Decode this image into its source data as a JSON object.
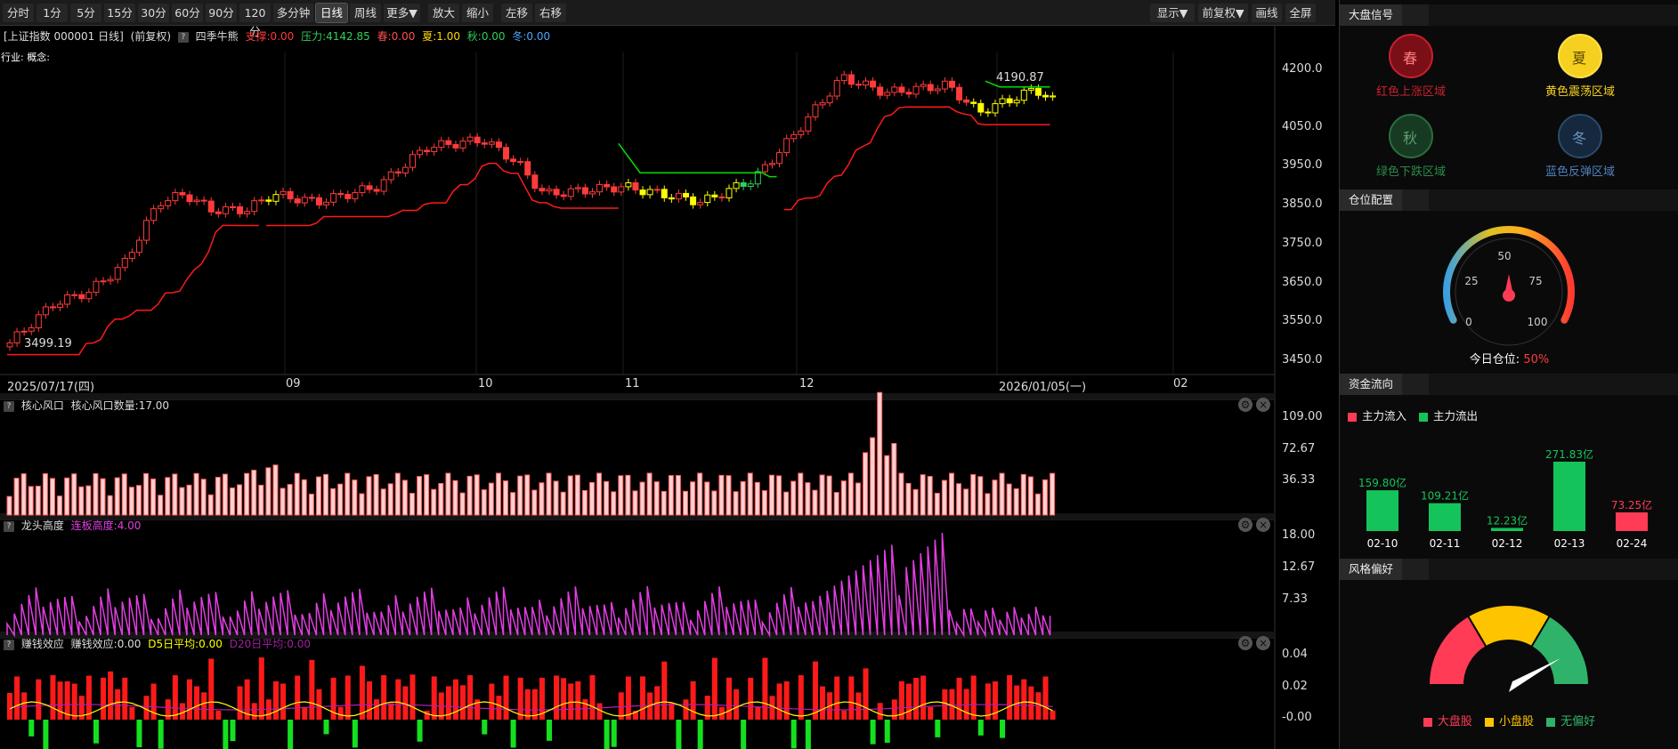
{
  "toolbar": {
    "periods": [
      "分时",
      "1分",
      "5分",
      "15分",
      "30分",
      "60分",
      "90分",
      "120分",
      "多分钟",
      "日线",
      "周线",
      "更多▼",
      "放大",
      "缩小",
      "左移",
      "右移"
    ],
    "active": "日线",
    "right": [
      "显示▼",
      "前复权▼",
      "画线",
      "全屏"
    ]
  },
  "main_header": {
    "title": "[上证指数 000001 日线]",
    "adj": "(前复权)",
    "indicator": "四季牛熊",
    "support": "支撑:0.00",
    "pressure": "压力:4142.85",
    "spring": "春:0.00",
    "summer": "夏:1.00",
    "autumn": "秋:0.00",
    "winter": "冬:0.00",
    "industry": "行业: 概念:"
  },
  "main_axis": {
    "ticks": [
      "4200.0",
      "4050.0",
      "3950.0",
      "3850.0",
      "3750.0",
      "3650.0",
      "3550.0",
      "3450.0"
    ],
    "dates": [
      "2025/07/17(四)",
      "09",
      "10",
      "11",
      "12",
      "2026/01/05(一)",
      "02"
    ],
    "high_label": "4190.87",
    "low_label": "3499.19"
  },
  "panel1": {
    "name": "核心风口",
    "value": "核心风口数量:17.00",
    "ticks": [
      "109.00",
      "72.67",
      "36.33"
    ]
  },
  "panel2": {
    "name": "龙头高度",
    "value": "连板高度:4.00",
    "ticks": [
      "18.00",
      "12.67",
      "7.33"
    ]
  },
  "panel3": {
    "name": "赚钱效应",
    "value": "赚钱效应:0.00",
    "d5": "D5日平均:0.00",
    "d20": "D20日平均:0.00",
    "ticks": [
      "0.04",
      "0.02",
      "-0.00"
    ]
  },
  "colors": {
    "up": "#ff3b3b",
    "down_green": "#2fd05a",
    "yellow": "#ffff00",
    "support_red": "#ff1a1a",
    "pressure_green": "#00e000",
    "magenta": "#e23ee2",
    "bar_pink": "#ff9a9a"
  },
  "side": {
    "signal": {
      "title": "大盘信号",
      "items": [
        {
          "glyph": "春",
          "label": "红色上涨区域",
          "color": "#c8202c"
        },
        {
          "glyph": "夏",
          "label": "黄色震荡区域",
          "color": "#f5d020"
        },
        {
          "glyph": "秋",
          "label": "绿色下跌区域",
          "color": "#2a6e3c"
        },
        {
          "glyph": "冬",
          "label": "蓝色反弹区域",
          "color": "#2b4a6e"
        }
      ]
    },
    "position": {
      "title": "仓位配置",
      "ticks": [
        "0",
        "25",
        "50",
        "75",
        "100"
      ],
      "today_label": "今日仓位:",
      "today_value": "50%",
      "value": 50
    },
    "flow": {
      "title": "资金流向",
      "legend_in": "主力流入",
      "legend_out": "主力流出",
      "bars": [
        {
          "date": "02-10",
          "label": "159.80亿",
          "value": 159.8,
          "dir": "out"
        },
        {
          "date": "02-11",
          "label": "109.21亿",
          "value": 109.21,
          "dir": "out"
        },
        {
          "date": "02-12",
          "label": "12.23亿",
          "value": 12.23,
          "dir": "out"
        },
        {
          "date": "02-13",
          "label": "271.83亿",
          "value": 271.83,
          "dir": "out"
        },
        {
          "date": "02-24",
          "label": "73.25亿",
          "value": 73.25,
          "dir": "in"
        }
      ]
    },
    "style": {
      "title": "风格偏好",
      "legend": [
        {
          "label": "大盘股",
          "color": "#ff3b55"
        },
        {
          "label": "小盘股",
          "color": "#ffc400"
        },
        {
          "label": "无偏好",
          "color": "#2fb36a"
        }
      ]
    }
  }
}
